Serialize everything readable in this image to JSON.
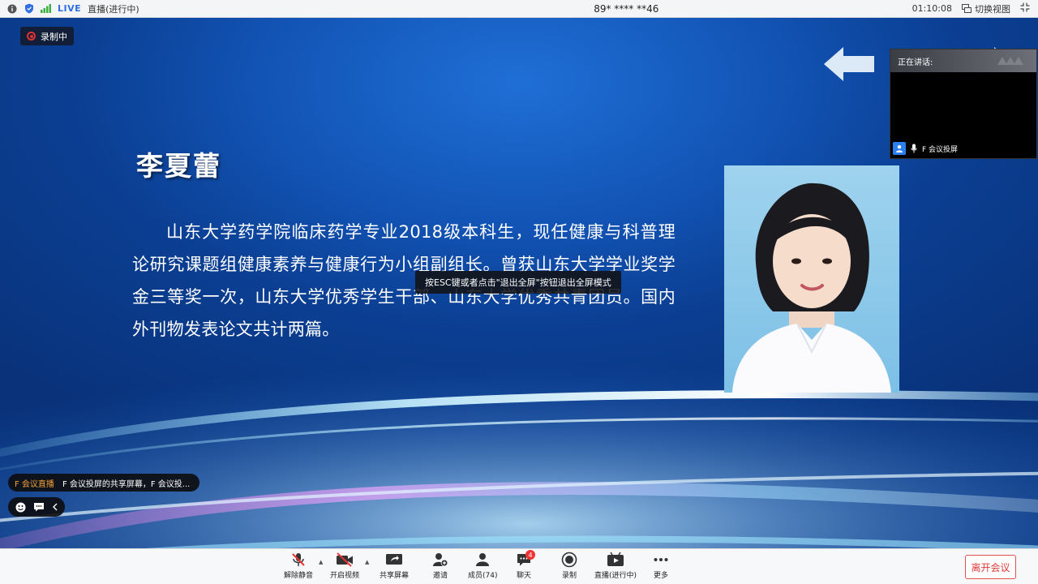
{
  "topbar": {
    "live_label": "LIVE",
    "status": "直播(进行中)",
    "meeting_id": "89* **** **46",
    "timer": "01:10:08",
    "switch_view": "切换视图"
  },
  "recording_badge": "录制中",
  "slide": {
    "name": "李夏蕾",
    "bio": "山东大学药学院临床药学专业2018级本科生，现任健康与科普理论研究课题组健康素养与健康行为小组副组长。曾获山东大学学业奖学金三等奖一次，山东大学优秀学生干部、山东大学优秀共青团员。国内外刊物发表论文共计两篇。"
  },
  "toast": "按ESC键或者点击\"退出全屏\"按钮退出全屏模式",
  "speaker_panel": {
    "title": "正在讲话:",
    "participant": "F 会议投屏"
  },
  "chat": {
    "tag": "F 会议直播",
    "message": "F 会议投屏的共享屏幕，F 会议投..."
  },
  "toolbar": {
    "unmute": "解除静音",
    "start_video": "开启视频",
    "share_screen": "共享屏幕",
    "invite": "邀请",
    "members": "成员(74)",
    "chat": "聊天",
    "chat_badge": "4",
    "record": "录制",
    "live": "直播(进行中)",
    "more": "更多",
    "leave": "离开会议"
  },
  "colors": {
    "accent_blue": "#2f6fe0",
    "slide_bg": "#1254b5",
    "leave_red": "#e03a3a",
    "chat_tag": "#f5a03a"
  }
}
